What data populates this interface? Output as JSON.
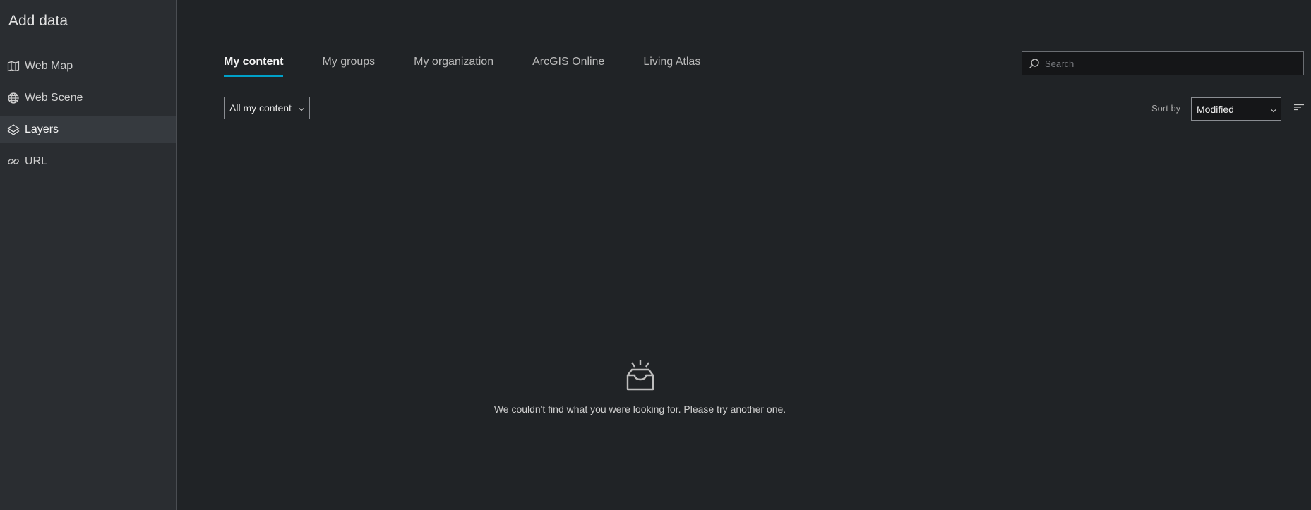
{
  "sidebar": {
    "title": "Add data",
    "items": [
      {
        "label": "Web Map",
        "icon": "map-icon"
      },
      {
        "label": "Web Scene",
        "icon": "globe-icon"
      },
      {
        "label": "Layers",
        "icon": "layers-icon",
        "active": true
      },
      {
        "label": "URL",
        "icon": "link-icon"
      }
    ]
  },
  "tabs": [
    {
      "label": "My content",
      "active": true
    },
    {
      "label": "My groups"
    },
    {
      "label": "My organization"
    },
    {
      "label": "ArcGIS Online"
    },
    {
      "label": "Living Atlas"
    }
  ],
  "search": {
    "placeholder": "Search",
    "value": ""
  },
  "filter": {
    "selected": "All my content"
  },
  "sort": {
    "label": "Sort by",
    "selected": "Modified"
  },
  "empty_state": {
    "icon": "empty-inbox-icon",
    "message": "We couldn't find what you were looking for. Please try another one."
  },
  "colors": {
    "accent": "#00a0c8",
    "background": "#202326",
    "sidebar": "#2a2d31"
  }
}
